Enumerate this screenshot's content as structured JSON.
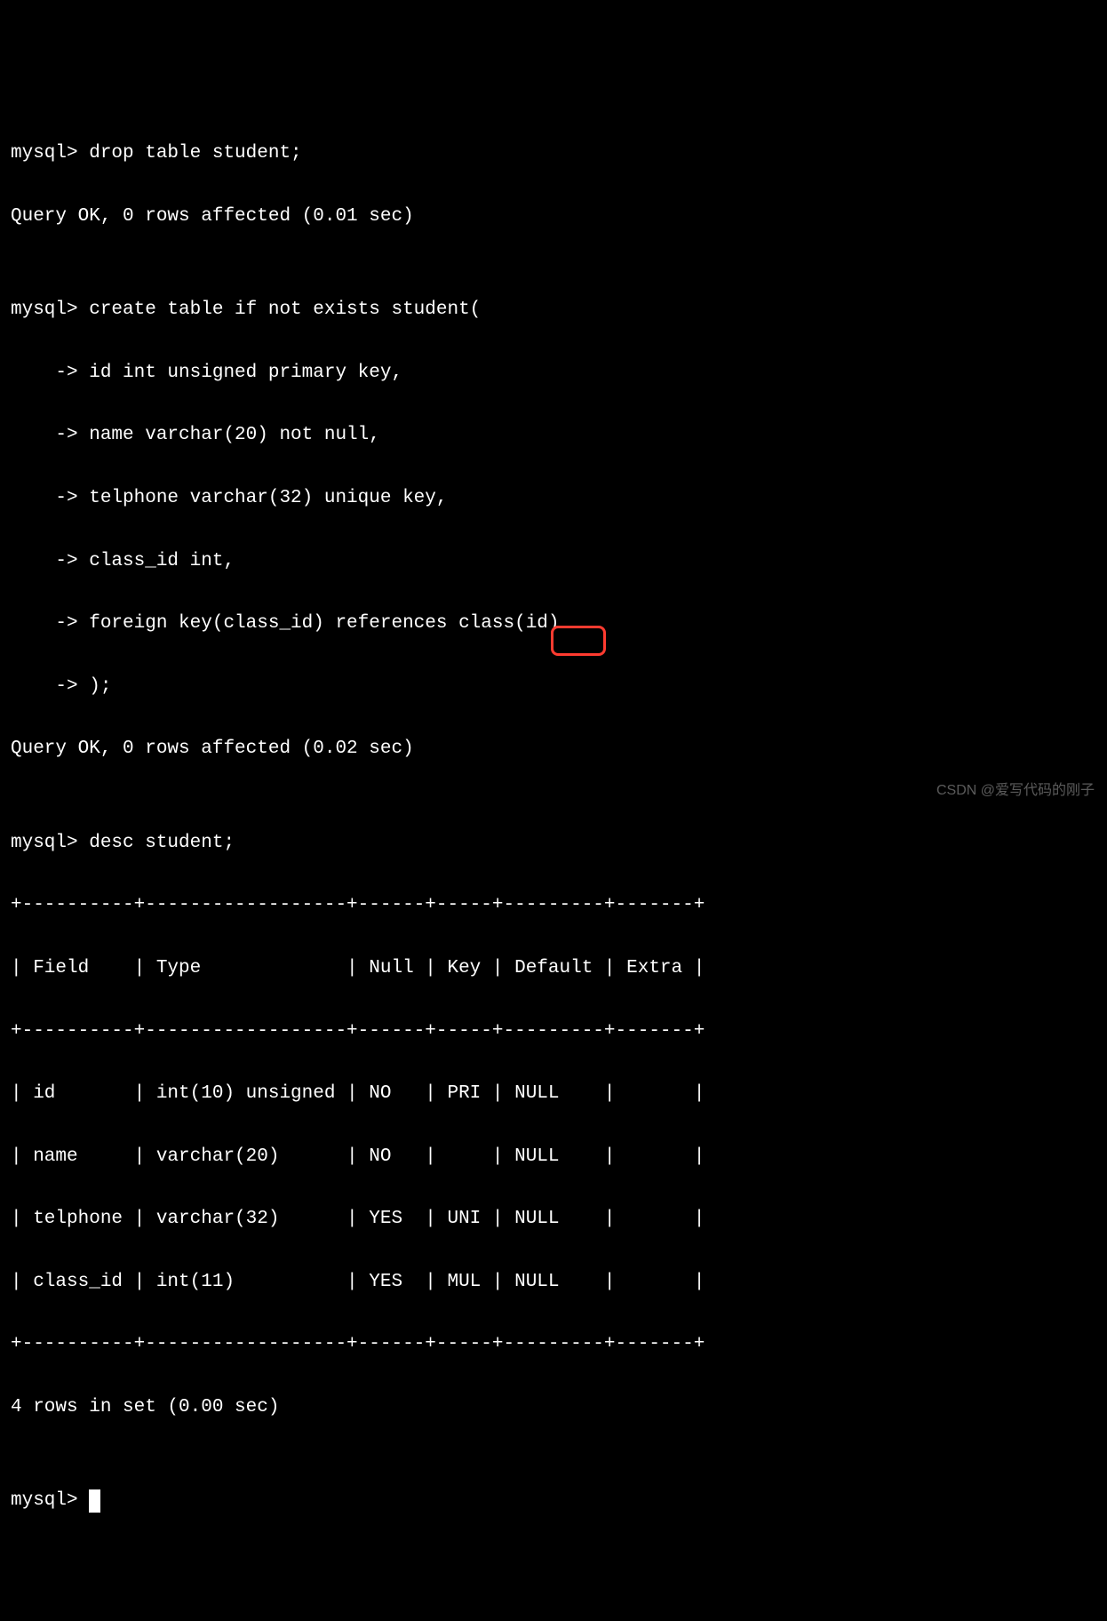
{
  "lines": {
    "l0": "mysql> drop table student;",
    "l1": "Query OK, 0 rows affected (0.01 sec)",
    "l2": "",
    "l3": "mysql> create table if not exists student(",
    "l4": "    -> id int unsigned primary key,",
    "l5": "    -> name varchar(20) not null,",
    "l6": "    -> telphone varchar(32) unique key,",
    "l7": "    -> class_id int,",
    "l8": "    -> foreign key(class_id) references class(id)",
    "l9": "    -> );",
    "l10": "Query OK, 0 rows affected (0.02 sec)",
    "l11": "",
    "l12": "mysql> desc student;",
    "l13": "+----------+------------------+------+-----+---------+-------+",
    "l14": "| Field    | Type             | Null | Key | Default | Extra |",
    "l15": "+----------+------------------+------+-----+---------+-------+",
    "l16": "| id       | int(10) unsigned | NO   | PRI | NULL    |       |",
    "l17": "| name     | varchar(20)      | NO   |     | NULL    |       |",
    "l18": "| telphone | varchar(32)      | YES  | UNI | NULL    |       |",
    "l19": "| class_id | int(11)          | YES  | MUL | NULL    |       |",
    "l20": "+----------+------------------+------+-----+---------+-------+",
    "l21": "4 rows in set (0.00 sec)",
    "l22": "",
    "l23": "mysql> "
  },
  "prompt": "mysql>",
  "watermark": "CSDN @爱写代码的刚子",
  "highlight": {
    "text": "MUL",
    "row": 19,
    "column": "Key"
  },
  "table": {
    "headers": [
      "Field",
      "Type",
      "Null",
      "Key",
      "Default",
      "Extra"
    ],
    "rows": [
      {
        "Field": "id",
        "Type": "int(10) unsigned",
        "Null": "NO",
        "Key": "PRI",
        "Default": "NULL",
        "Extra": ""
      },
      {
        "Field": "name",
        "Type": "varchar(20)",
        "Null": "NO",
        "Key": "",
        "Default": "NULL",
        "Extra": ""
      },
      {
        "Field": "telphone",
        "Type": "varchar(32)",
        "Null": "YES",
        "Key": "UNI",
        "Default": "NULL",
        "Extra": ""
      },
      {
        "Field": "class_id",
        "Type": "int(11)",
        "Null": "YES",
        "Key": "MUL",
        "Default": "NULL",
        "Extra": ""
      }
    ],
    "footer": "4 rows in set (0.00 sec)"
  },
  "commands": [
    "drop table student;",
    "create table if not exists student( id int unsigned primary key, name varchar(20) not null, telphone varchar(32) unique key, class_id int, foreign key(class_id) references class(id) );",
    "desc student;"
  ]
}
